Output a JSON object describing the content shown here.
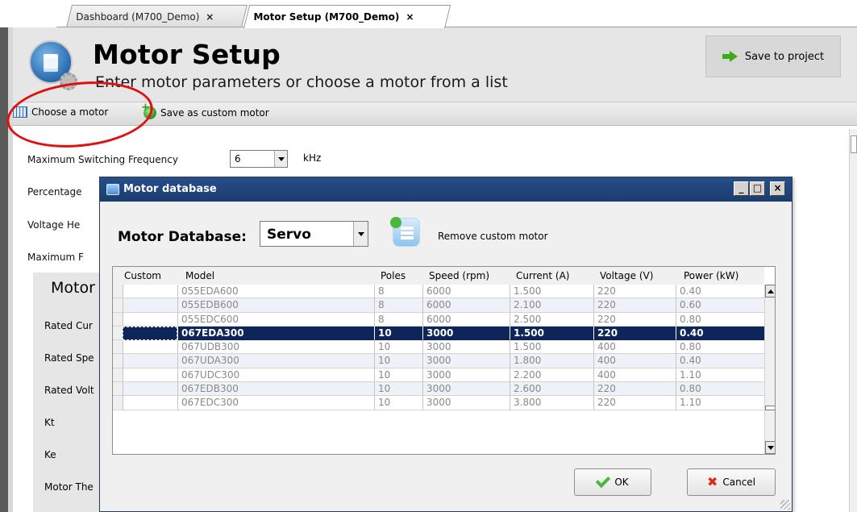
{
  "tabs": [
    {
      "label": "Dashboard (M700_Demo)",
      "close": "×"
    },
    {
      "label": "Motor Setup (M700_Demo)",
      "close": "×"
    }
  ],
  "header": {
    "title": "Motor Setup",
    "subtitle": "Enter motor parameters or choose a motor from a list",
    "save_to_project": "Save to project"
  },
  "toolbar": {
    "choose_motor": "Choose a motor",
    "save_custom": "Save as custom motor"
  },
  "form": {
    "max_switching_label": "Maximum Switching Frequency",
    "max_switching_value": "6",
    "max_switching_unit": "kHz",
    "partial_labels": [
      "Percentage",
      "Voltage He",
      "Maximum F"
    ],
    "motor_panel_title": "Motor",
    "motor_panel_labels": [
      "Rated Cur",
      "Rated Spe",
      "Rated Volt",
      "Kt",
      "Ke",
      "Motor The"
    ]
  },
  "dialog": {
    "title": "Motor database",
    "db_label": "Motor Database:",
    "db_value": "Servo",
    "remove_custom": "Remove custom motor",
    "ok": "OK",
    "cancel": "Cancel",
    "columns": [
      "Custom",
      "Model",
      "Poles",
      "Speed (rpm)",
      "Current (A)",
      "Voltage (V)",
      "Power (kW)"
    ],
    "rows": [
      {
        "custom": "",
        "model": "055EDA600",
        "poles": "8",
        "speed": "6000",
        "current": "1.500",
        "voltage": "220",
        "power": "0.40"
      },
      {
        "custom": "",
        "model": "055EDB600",
        "poles": "8",
        "speed": "6000",
        "current": "2.100",
        "voltage": "220",
        "power": "0.60"
      },
      {
        "custom": "",
        "model": "055EDC600",
        "poles": "8",
        "speed": "6000",
        "current": "2.500",
        "voltage": "220",
        "power": "0.80"
      },
      {
        "custom": "",
        "model": "067EDA300",
        "poles": "10",
        "speed": "3000",
        "current": "1.500",
        "voltage": "220",
        "power": "0.40"
      },
      {
        "custom": "",
        "model": "067UDB300",
        "poles": "10",
        "speed": "3000",
        "current": "1.500",
        "voltage": "400",
        "power": "0.80"
      },
      {
        "custom": "",
        "model": "067UDA300",
        "poles": "10",
        "speed": "3000",
        "current": "1.800",
        "voltage": "400",
        "power": "0.40"
      },
      {
        "custom": "",
        "model": "067UDC300",
        "poles": "10",
        "speed": "3000",
        "current": "2.200",
        "voltage": "400",
        "power": "1.10"
      },
      {
        "custom": "",
        "model": "067EDB300",
        "poles": "10",
        "speed": "3000",
        "current": "2.600",
        "voltage": "220",
        "power": "0.80"
      },
      {
        "custom": "",
        "model": "067EDC300",
        "poles": "10",
        "speed": "3000",
        "current": "3.800",
        "voltage": "220",
        "power": "1.10"
      }
    ],
    "selected_row": 3
  },
  "colors": {
    "selection": "#0d2559",
    "title_bar": "#1b3c6e",
    "annotation": "#e01010",
    "accent_green": "#3dab18"
  }
}
